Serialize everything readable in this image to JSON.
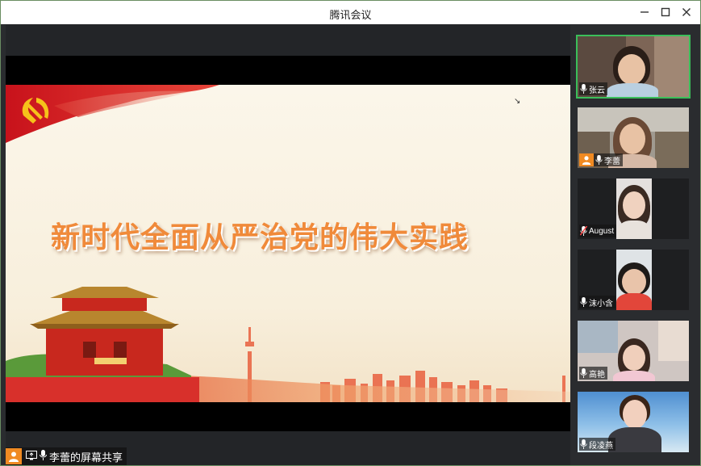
{
  "window": {
    "title": "腾讯会议",
    "minimize_glyph": "—",
    "maximize_glyph": "☐",
    "close_glyph": "✕"
  },
  "slide": {
    "title": "新时代全面从严治党的伟大实践"
  },
  "screen_share": {
    "label": "李蕾的屏幕共享"
  },
  "participants": [
    {
      "name": "张云",
      "active": true,
      "muted": false,
      "icon": "mic-icon"
    },
    {
      "name": "李蕾",
      "active": false,
      "muted": false,
      "icon": "mic-icon",
      "host": true
    },
    {
      "name": "August",
      "active": false,
      "muted": true,
      "icon": "mic-muted-icon"
    },
    {
      "name": "沫小含",
      "active": false,
      "muted": false,
      "icon": "mic-icon"
    },
    {
      "name": "高艳",
      "active": false,
      "muted": false,
      "icon": "mic-icon"
    },
    {
      "name": "段凌燕",
      "active": false,
      "muted": false,
      "icon": "mic-icon"
    }
  ],
  "colors": {
    "accent_green": "#3bbf5a",
    "slide_title": "#f08a3a",
    "party_red": "#d7261f",
    "host_orange": "#f08a22"
  }
}
